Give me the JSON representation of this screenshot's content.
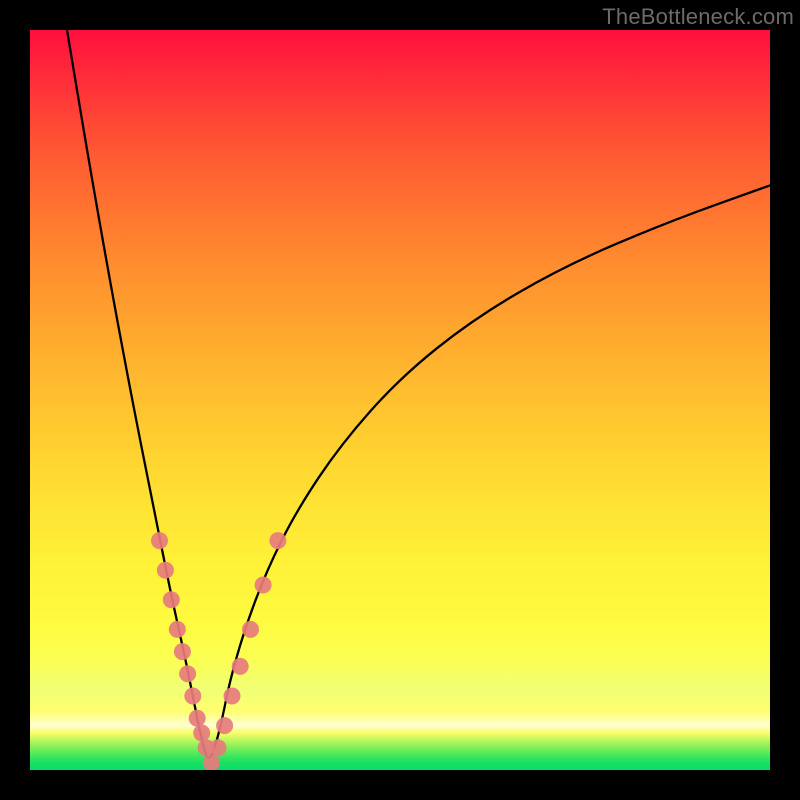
{
  "watermark": "TheBottleneck.com",
  "chart_data": {
    "type": "line",
    "title": "",
    "xlabel": "",
    "ylabel": "",
    "xlim": [
      0,
      100
    ],
    "ylim": [
      0,
      100
    ],
    "grid": false,
    "legend": false,
    "comment": "Axes are unlabeled in the source image. Values below are estimated from pixel positions; y represents the height of the V-shaped black curve (0 = bottom/green, 100 = top/red). The curve minimum (optimum) is near x≈24. Pink dots mark sampled points on the curve near the minimum.",
    "series": [
      {
        "name": "curve",
        "type": "line",
        "color": "#000000",
        "x": [
          5,
          8,
          11,
          14,
          17,
          19,
          21,
          22,
          23,
          24,
          25,
          26,
          27,
          29,
          32,
          36,
          42,
          50,
          60,
          72,
          86,
          100
        ],
        "y": [
          100,
          82,
          65,
          49,
          34,
          24,
          15,
          10,
          5,
          1,
          3,
          7,
          12,
          19,
          27,
          35,
          44,
          53,
          61,
          68,
          74,
          79
        ]
      },
      {
        "name": "samples",
        "type": "scatter",
        "color": "#e77b7d",
        "x": [
          17.5,
          18.3,
          19.1,
          19.9,
          20.6,
          21.3,
          22.0,
          22.6,
          23.2,
          23.8,
          24.5,
          25.4,
          26.3,
          27.3,
          28.4,
          29.8,
          31.5,
          33.5
        ],
        "y": [
          31,
          27,
          23,
          19,
          16,
          13,
          10,
          7,
          5,
          3,
          1,
          3,
          6,
          10,
          14,
          19,
          25,
          31
        ]
      }
    ],
    "background_gradient": {
      "direction": "vertical",
      "stops": [
        {
          "pos": 0.0,
          "color": "#ff103e"
        },
        {
          "pos": 0.25,
          "color": "#ff7630"
        },
        {
          "pos": 0.55,
          "color": "#ffd030"
        },
        {
          "pos": 0.8,
          "color": "#fffb40"
        },
        {
          "pos": 0.95,
          "color": "#fafd68"
        },
        {
          "pos": 1.0,
          "color": "#0ade66"
        }
      ]
    }
  }
}
